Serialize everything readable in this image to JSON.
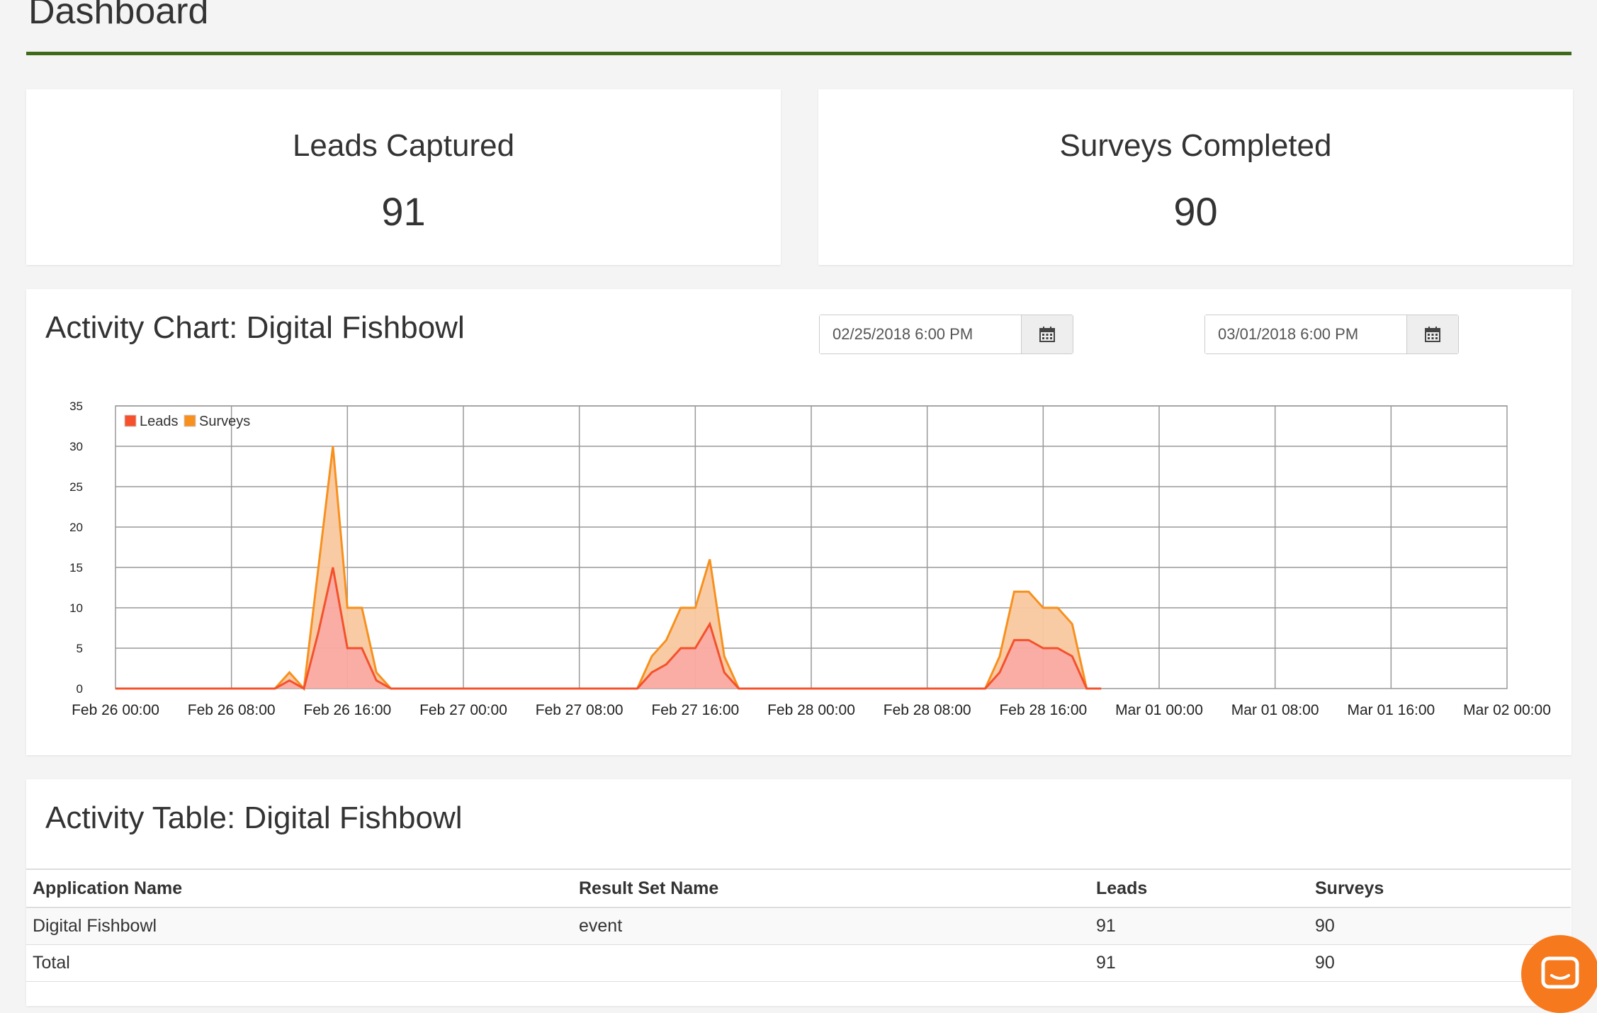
{
  "header": {
    "title": "Dashboard"
  },
  "stats": [
    {
      "label": "Leads Captured",
      "value": "91"
    },
    {
      "label": "Surveys Completed",
      "value": "90"
    }
  ],
  "activity_chart": {
    "title": "Activity Chart: Digital Fishbowl",
    "start_date": "02/25/2018 6:00 PM",
    "end_date": "03/01/2018 6:00 PM"
  },
  "chart_data": {
    "type": "area",
    "stacked": true,
    "x_unit": "hours since Feb 26 00:00",
    "x_ticks": [
      "Feb 26 00:00",
      "Feb 26 08:00",
      "Feb 26 16:00",
      "Feb 27 00:00",
      "Feb 27 08:00",
      "Feb 27 16:00",
      "Feb 28 00:00",
      "Feb 28 08:00",
      "Feb 28 16:00",
      "Mar 01 00:00",
      "Mar 01 08:00",
      "Mar 01 16:00",
      "Mar 02 00:00"
    ],
    "y_ticks": [
      "0",
      "5",
      "10",
      "15",
      "20",
      "25",
      "30",
      "35"
    ],
    "ylim": [
      0,
      35
    ],
    "legend": "top-left",
    "grid": true,
    "series": [
      {
        "name": "Leads",
        "color": "#f4512c",
        "x": [
          0,
          11,
          12,
          13,
          14,
          15,
          16,
          17,
          18,
          19,
          36,
          37,
          38,
          39,
          40,
          41,
          42,
          43,
          44,
          60,
          61,
          62,
          63,
          64,
          65,
          66,
          67,
          68
        ],
        "values": [
          0,
          0,
          1,
          0,
          7,
          15,
          5,
          5,
          1,
          0,
          0,
          2,
          3,
          5,
          5,
          8,
          2,
          0,
          0,
          0,
          2,
          6,
          6,
          5,
          5,
          4,
          0,
          0
        ]
      },
      {
        "name": "Surveys",
        "color": "#f7901e",
        "x": [
          0,
          11,
          12,
          13,
          14,
          15,
          16,
          17,
          18,
          19,
          36,
          37,
          38,
          39,
          40,
          41,
          42,
          43,
          44,
          60,
          61,
          62,
          63,
          64,
          65,
          66,
          67,
          68
        ],
        "values": [
          0,
          0,
          1,
          0,
          8,
          15,
          5,
          5,
          1,
          0,
          0,
          2,
          3,
          5,
          5,
          8,
          2,
          0,
          0,
          0,
          2,
          6,
          6,
          5,
          5,
          4,
          0,
          0
        ]
      }
    ]
  },
  "activity_table": {
    "title": "Activity Table: Digital Fishbowl",
    "headers": [
      "Application Name",
      "Result Set Name",
      "Leads",
      "Surveys"
    ],
    "rows": [
      [
        "Digital Fishbowl",
        "event",
        "91",
        "90"
      ],
      [
        "Total",
        "",
        "91",
        "90"
      ]
    ]
  }
}
